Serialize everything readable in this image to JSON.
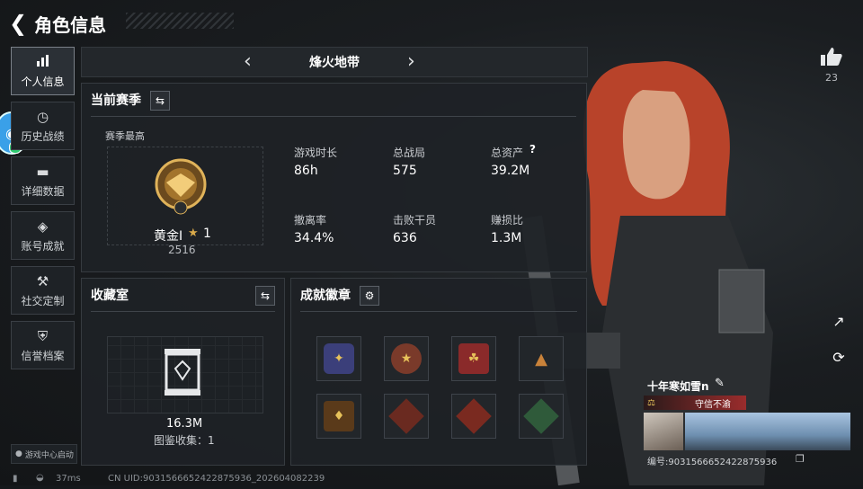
{
  "header": {
    "title": "角色信息"
  },
  "sidebar": {
    "items": [
      {
        "label": "个人信息",
        "icon": "bar-chart-icon",
        "active": true
      },
      {
        "label": "历史战绩",
        "icon": "clock-icon",
        "active": false
      },
      {
        "label": "详细数据",
        "icon": "folder-icon",
        "active": false
      },
      {
        "label": "账号成就",
        "icon": "diamond-icon",
        "active": false
      },
      {
        "label": "社交定制",
        "icon": "tools-icon",
        "active": false
      },
      {
        "label": "信誉档案",
        "icon": "shield-icon",
        "active": false
      }
    ]
  },
  "mode": {
    "name": "烽火地带"
  },
  "season": {
    "title": "当前赛季",
    "highest_label": "赛季最高",
    "rank_name": "黄金Ⅰ",
    "rank_stars": "1",
    "rank_score": "2516",
    "stats": [
      {
        "label": "游戏时长",
        "value": "86h"
      },
      {
        "label": "总战局",
        "value": "575"
      },
      {
        "label": "总资产",
        "value": "39.2M"
      },
      {
        "label": "撤离率",
        "value": "34.4%"
      },
      {
        "label": "击败干员",
        "value": "636"
      },
      {
        "label": "赚损比",
        "value": "1.3M"
      }
    ],
    "help_symbol": "?"
  },
  "collection": {
    "title": "收藏室",
    "value": "16.3M",
    "caption": "图鉴收集：1"
  },
  "achievements": {
    "title": "成就徽章"
  },
  "likes": {
    "count": "23"
  },
  "player": {
    "name": "十年寒如雪n",
    "credit": "守信不渝",
    "id_line": "编号:9031566652422875936"
  },
  "footer": {
    "game_center": "游戏中心启动",
    "ping": "37ms",
    "uid": "CN UID:9031566652422875936_202604082239"
  },
  "colors": {
    "accent": "#d9a94a",
    "credit_red": "#9a2c2c",
    "active_border": "#7a8088"
  }
}
